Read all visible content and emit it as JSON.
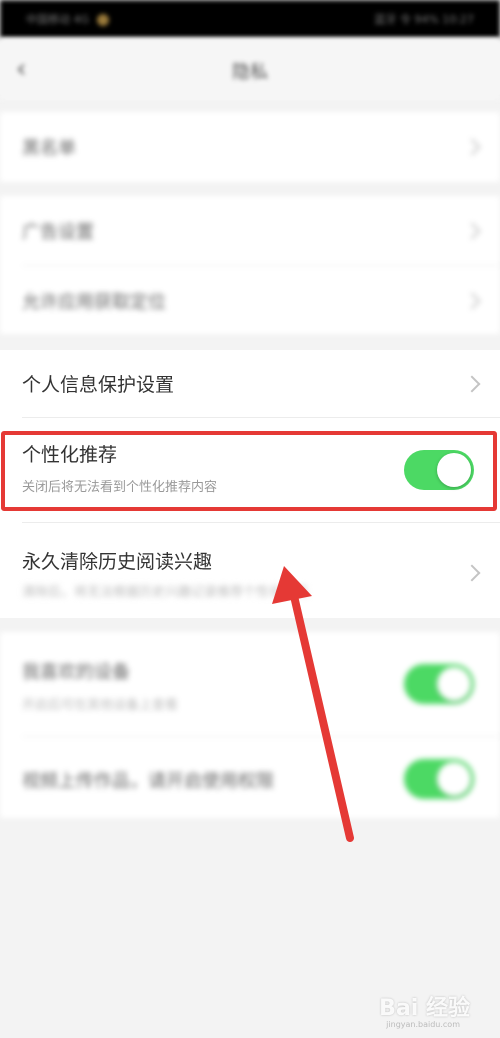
{
  "status_bar": {
    "left": "中国移动 4G",
    "right": "蓝牙 令 94% 10:27"
  },
  "header": {
    "back_icon": "chevron-left-icon",
    "title": "隐私"
  },
  "blurred_rows": [
    {
      "label": "黑名单"
    },
    {
      "label": "广告设置"
    },
    {
      "label": "允许应用获取定位"
    }
  ],
  "privacy_protection": {
    "label": "个人信息保护设置"
  },
  "personalized": {
    "label": "个性化推荐",
    "sublabel": "关闭后将无法看到个性化推荐内容",
    "toggle_on": true,
    "toggle_color": "#4cd964"
  },
  "clear_history": {
    "label": "永久清除历史阅读兴趣",
    "sublabel": "清除后，将无法根据历史兴趣记录推荐个性化资讯"
  },
  "lower_rows": [
    {
      "label": "我喜欢的设备",
      "sublabel": "开启后可在其他设备上查看"
    },
    {
      "label": "视频上传作品，请开启使用权限"
    }
  ],
  "annotation": {
    "highlight_color": "#e53935",
    "arrow_color": "#e53935"
  },
  "watermark": {
    "text": "Bai 经验",
    "sub": "jingyan.baidu.com"
  }
}
